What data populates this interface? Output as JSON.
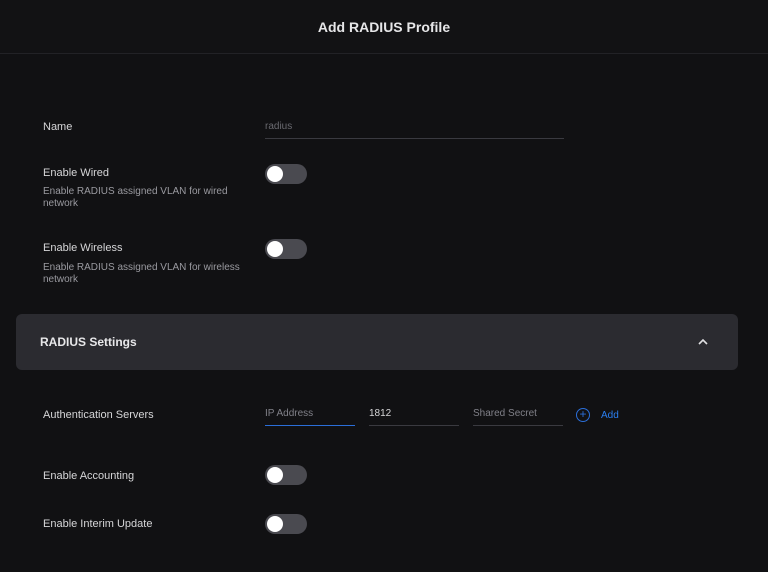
{
  "header": {
    "title": "Add RADIUS Profile"
  },
  "name": {
    "label": "Name",
    "value": "radius"
  },
  "wired": {
    "label": "Enable Wired",
    "description": "Enable RADIUS assigned VLAN for wired network",
    "enabled": false
  },
  "wireless": {
    "label": "Enable Wireless",
    "description": "Enable RADIUS assigned VLAN for wireless network",
    "enabled": false
  },
  "radius_settings": {
    "title": "RADIUS Settings",
    "expanded": true
  },
  "auth_servers": {
    "label": "Authentication Servers",
    "ip_placeholder": "IP Address",
    "port_value": "1812",
    "secret_placeholder": "Shared Secret",
    "add_label": "Add"
  },
  "accounting": {
    "label": "Enable Accounting",
    "enabled": false
  },
  "interim_update": {
    "label": "Enable Interim Update",
    "enabled": false
  },
  "colors": {
    "accent": "#2b6ed8",
    "background": "#111113",
    "section_bg": "#2b2b30",
    "toggle_off": "#4a4a50"
  }
}
